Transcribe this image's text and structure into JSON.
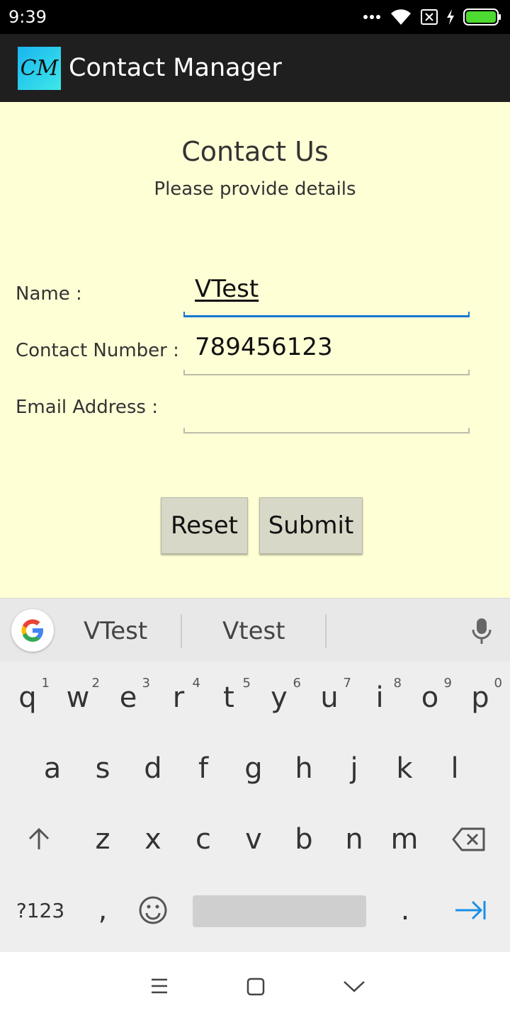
{
  "status_bar": {
    "time": "9:39"
  },
  "app_bar": {
    "logo_text": "CM",
    "title": "Contact Manager"
  },
  "form": {
    "title": "Contact Us",
    "subtitle": "Please provide details",
    "name_label": "Name :",
    "name_value": "VTest",
    "contact_label": "Contact Number :",
    "contact_value": "789456123",
    "email_label": "Email Address :",
    "email_value": "",
    "reset_label": "Reset",
    "submit_label": "Submit"
  },
  "keyboard": {
    "suggestions": [
      "VTest",
      "Vtest"
    ],
    "row1": [
      {
        "k": "q",
        "h": "1"
      },
      {
        "k": "w",
        "h": "2"
      },
      {
        "k": "e",
        "h": "3"
      },
      {
        "k": "r",
        "h": "4"
      },
      {
        "k": "t",
        "h": "5"
      },
      {
        "k": "y",
        "h": "6"
      },
      {
        "k": "u",
        "h": "7"
      },
      {
        "k": "i",
        "h": "8"
      },
      {
        "k": "o",
        "h": "9"
      },
      {
        "k": "p",
        "h": "0"
      }
    ],
    "row2": [
      "a",
      "s",
      "d",
      "f",
      "g",
      "h",
      "j",
      "k",
      "l"
    ],
    "row3": [
      "z",
      "x",
      "c",
      "v",
      "b",
      "n",
      "m"
    ],
    "symbols_label": "?123",
    "comma": ",",
    "period": ".",
    "accent_color": "#1a8fe8"
  }
}
